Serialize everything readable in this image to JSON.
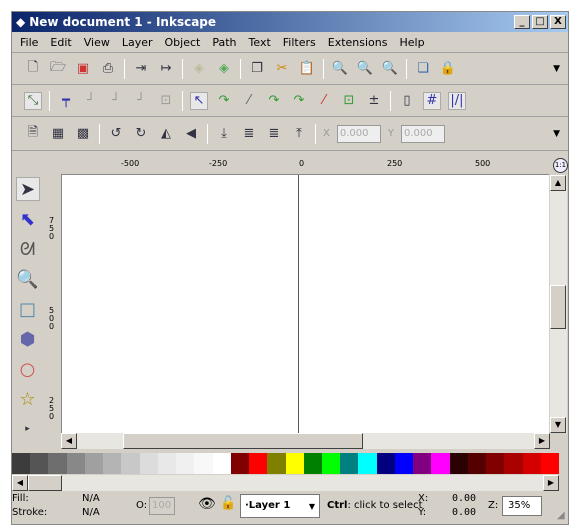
{
  "window": {
    "title": "New document 1 - Inkscape",
    "min": "_",
    "max": "□",
    "close": "X"
  },
  "menu": [
    "File",
    "Edit",
    "View",
    "Layer",
    "Object",
    "Path",
    "Text",
    "Filters",
    "Extensions",
    "Help"
  ],
  "ruler": {
    "h": [
      "-500",
      "-250",
      "0",
      "250",
      "500"
    ],
    "v": [
      "750",
      "500",
      "250"
    ],
    "zoom_1to1": "1:1"
  },
  "coords": {
    "x_label": "X",
    "x_value": "0.000",
    "y_label": "Y",
    "y_value": "0.000"
  },
  "palette": [
    "#3c3c3c",
    "#555",
    "#6e6e6e",
    "#888",
    "#a0a0a0",
    "#b4b4b4",
    "#c8c8c8",
    "#dcdcdc",
    "#e8e8e8",
    "#f0f0f0",
    "#f8f8f8",
    "#fff",
    "#800000",
    "#ff0000",
    "#808000",
    "#ffff00",
    "#008000",
    "#00ff00",
    "#008080",
    "#00ffff",
    "#000080",
    "#0000ff",
    "#800080",
    "#ff00ff",
    "#2a0000",
    "#550000",
    "#800000",
    "#aa0000",
    "#d40000",
    "#ff0000"
  ],
  "status": {
    "fill_label": "Fill:",
    "fill_value": "N/A",
    "stroke_label": "Stroke:",
    "stroke_value": "N/A",
    "opacity_label": "O:",
    "opacity_value": "100",
    "layer": "·Layer 1",
    "hint_key": "Ctrl",
    "hint_text": ": click to select",
    "x_label": "X:",
    "x_value": "0.00",
    "y_label": "Y:",
    "y_value": "0.00",
    "zoom_label": "Z:",
    "zoom_value": "35%"
  }
}
